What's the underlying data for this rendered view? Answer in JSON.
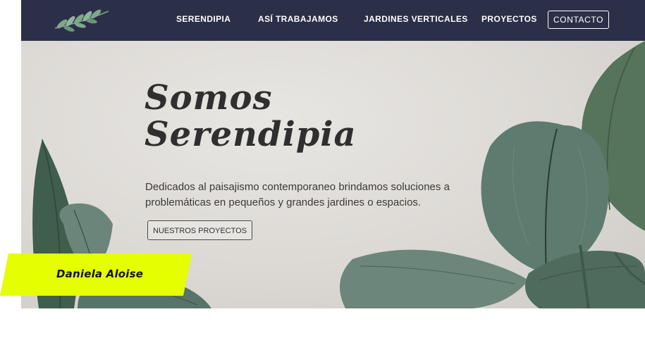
{
  "nav": {
    "items": [
      {
        "label": "SERENDIPIA"
      },
      {
        "label": "ASÍ TRABAJAMOS"
      },
      {
        "label": "JARDINES VERTICALES"
      },
      {
        "label": "PROYECTOS"
      }
    ],
    "contact_label": "CONTACTO"
  },
  "hero": {
    "title_line1": "Somos",
    "title_line2": "Serendipia",
    "description": "Dedicados al paisajismo contemporaneo brindamos soluciones a problemáticas en pequeños y grandes jardines o espacios.",
    "button_label": "NUESTROS PROYECTOS"
  },
  "tag": {
    "label": "Daniela Aloise"
  },
  "colors": {
    "nav_bg": "#2b2f48",
    "hero_bg": "#dcd9d5",
    "leaf_dark": "#4f6b5e",
    "tag_bg": "#e5ff00"
  },
  "icons": {
    "logo": "leaf-branch-logo"
  }
}
